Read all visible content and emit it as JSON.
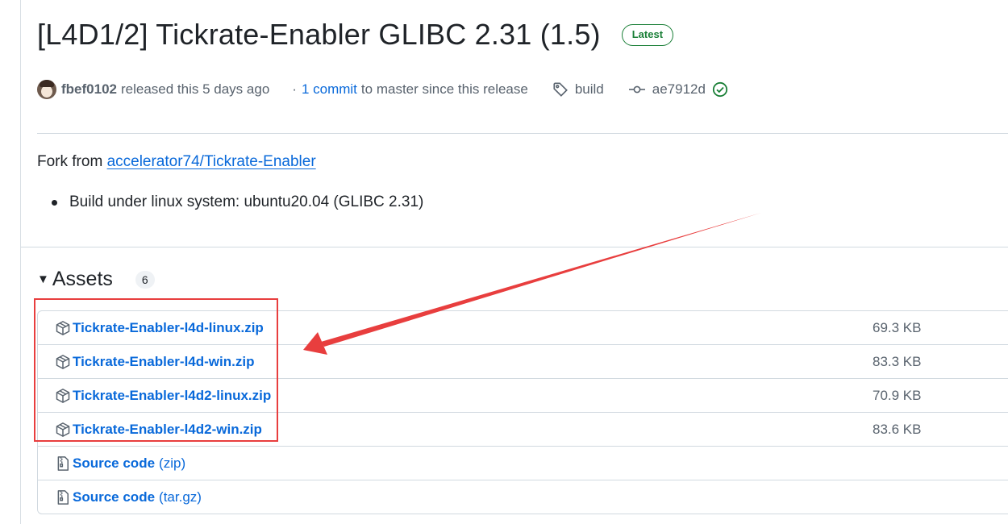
{
  "release": {
    "title": "[L4D1/2] Tickrate-Enabler GLIBC 2.31 (1.5)",
    "badge": "Latest",
    "author": "fbef0102",
    "released_text": "released this 5 days ago",
    "separator": "·",
    "commit_link": "1 commit",
    "commit_suffix": "to master since this release",
    "tag": "build",
    "commit_hash": "ae7912d"
  },
  "body": {
    "fork_prefix": "Fork from",
    "fork_link": "accelerator74/Tickrate-Enabler",
    "bullet": "Build under linux system: ubuntu20.04 (GLIBC 2.31)"
  },
  "assets": {
    "heading": "Assets",
    "count": "6",
    "items": [
      {
        "name": "Tickrate-Enabler-l4d-linux.zip",
        "size": "69.3 KB",
        "icon": "package-icon"
      },
      {
        "name": "Tickrate-Enabler-l4d-win.zip",
        "size": "83.3 KB",
        "icon": "package-icon"
      },
      {
        "name": "Tickrate-Enabler-l4d2-linux.zip",
        "size": "70.9 KB",
        "icon": "package-icon"
      },
      {
        "name": "Tickrate-Enabler-l4d2-win.zip",
        "size": "83.6 KB",
        "icon": "package-icon"
      },
      {
        "name": "Source code",
        "ext": "(zip)",
        "icon": "file-zip-icon"
      },
      {
        "name": "Source code",
        "ext": "(tar.gz)",
        "icon": "file-zip-icon"
      }
    ]
  },
  "colors": {
    "link": "#0969da",
    "success": "#1a7f37",
    "annotation": "#e83e3e",
    "muted": "#59636e"
  }
}
